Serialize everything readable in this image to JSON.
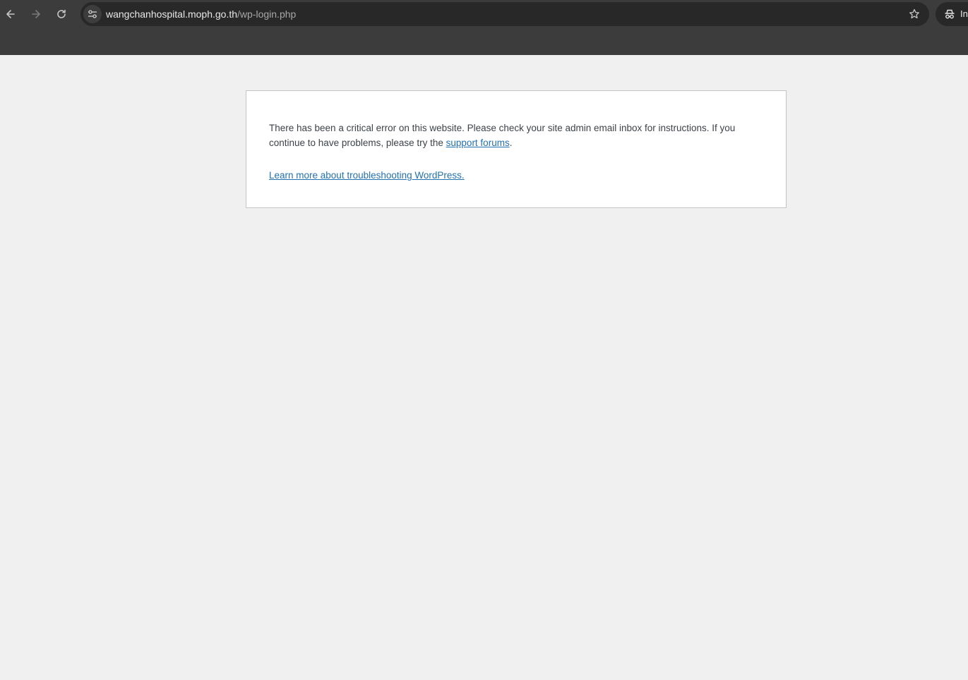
{
  "browser": {
    "url_host": "wangchanhospital.moph.go.th",
    "url_path": "/wp-login.php",
    "profile_label": "Incognito",
    "icons": {
      "back": "arrow-left-icon",
      "forward": "arrow-right-icon",
      "reload": "reload-icon",
      "site_info": "tune-icon",
      "bookmark": "star-icon",
      "incognito": "incognito-icon"
    }
  },
  "error": {
    "message_before_link": "There has been a critical error on this website. Please check your site admin email inbox for instructions. If you continue to have problems, please try the ",
    "support_link": "support forums",
    "message_after_link": ".",
    "learn_more_link": "Learn more about troubleshooting WordPress."
  },
  "colors": {
    "page_background": "#f0f0f1",
    "box_background": "#ffffff",
    "link": "#2271b1",
    "text": "#3c434a",
    "browser_chrome": "#3c3c3c"
  }
}
